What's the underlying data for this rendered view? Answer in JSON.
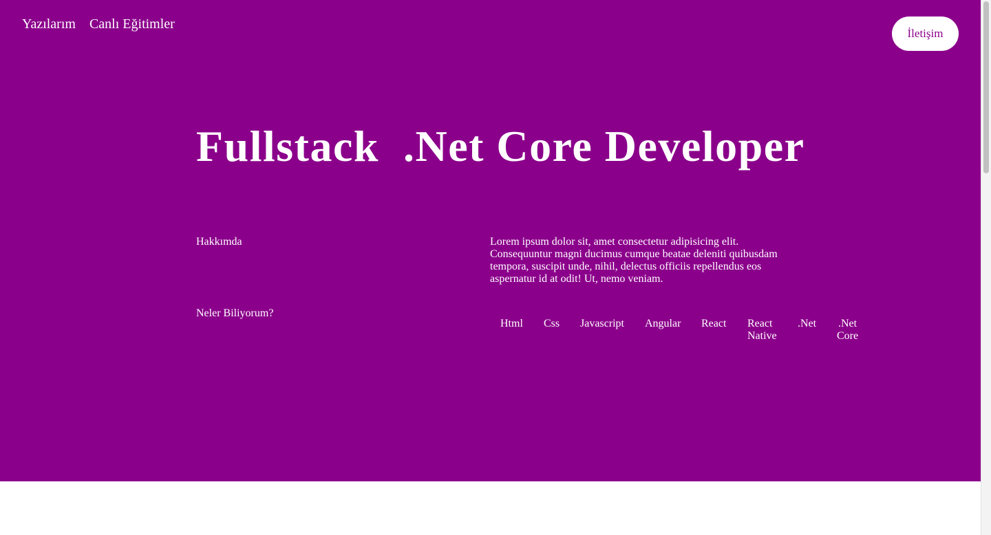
{
  "nav": {
    "items": [
      {
        "label": "Yazılarım"
      },
      {
        "label": "Canlı Eğitimler"
      }
    ],
    "contact_label": "İletişim"
  },
  "hero": {
    "title": "Fullstack  .Net Core Developer"
  },
  "about": {
    "label": "Hakkımda",
    "text": "Lorem ipsum dolor sit, amet consectetur adipisicing elit. Consequuntur magni ducimus cumque beatae deleniti quibusdam tempora, suscipit unde, nihil, delectus officiis repellendus eos aspernatur id at odit! Ut, nemo veniam."
  },
  "skills": {
    "label": "Neler Biliyorum?",
    "items": [
      {
        "label": "Html"
      },
      {
        "label": "Css"
      },
      {
        "label": "Javascript"
      },
      {
        "label": "Angular"
      },
      {
        "label": "React"
      },
      {
        "label": "React\nNative"
      },
      {
        "label": ".Net"
      },
      {
        "label": ".Net\nCore"
      }
    ]
  },
  "colors": {
    "brand": "#8b008b",
    "text_on_brand": "#ffffff",
    "background": "#ffffff"
  }
}
